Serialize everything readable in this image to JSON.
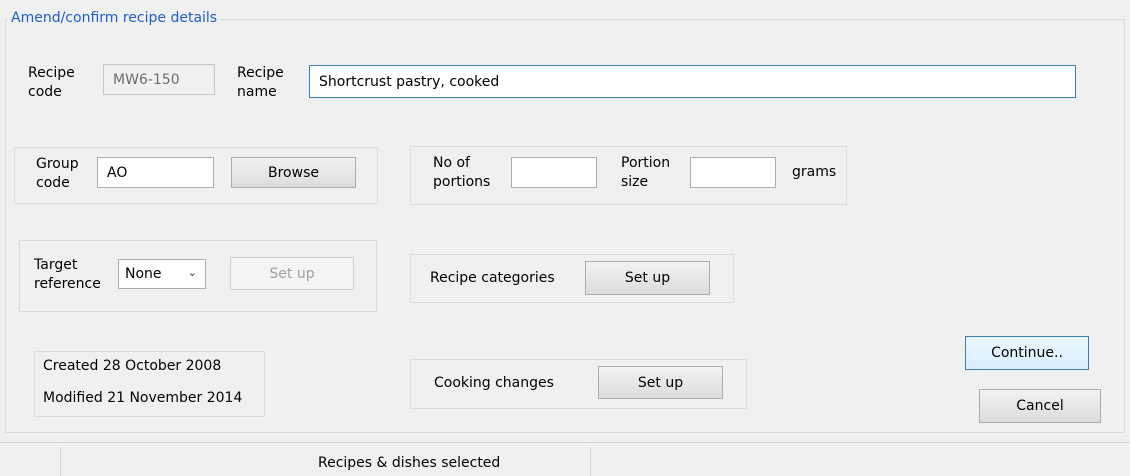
{
  "group_title": "Amend/confirm recipe details",
  "recipe_code": {
    "label": "Recipe\ncode",
    "value": "MW6-150"
  },
  "recipe_name": {
    "label": "Recipe\nname",
    "value": "Shortcrust pastry, cooked"
  },
  "group_code": {
    "label": "Group\ncode",
    "value": "AO",
    "browse": "Browse"
  },
  "portions": {
    "label": "No of\nportions",
    "value": ""
  },
  "portion_size": {
    "label": "Portion\nsize",
    "value": "",
    "unit": "grams"
  },
  "target_reference": {
    "label": "Target\nreference",
    "selected": "None",
    "setup": "Set up"
  },
  "recipe_categories": {
    "label": "Recipe categories",
    "setup": "Set up"
  },
  "dates": {
    "created": "Created 28 October 2008",
    "modified": "Modified 21 November 2014"
  },
  "cooking_changes": {
    "label": "Cooking changes",
    "setup": "Set up"
  },
  "buttons": {
    "continue": "Continue..",
    "cancel": "Cancel"
  },
  "status": {
    "selection": "Recipes & dishes selected"
  }
}
